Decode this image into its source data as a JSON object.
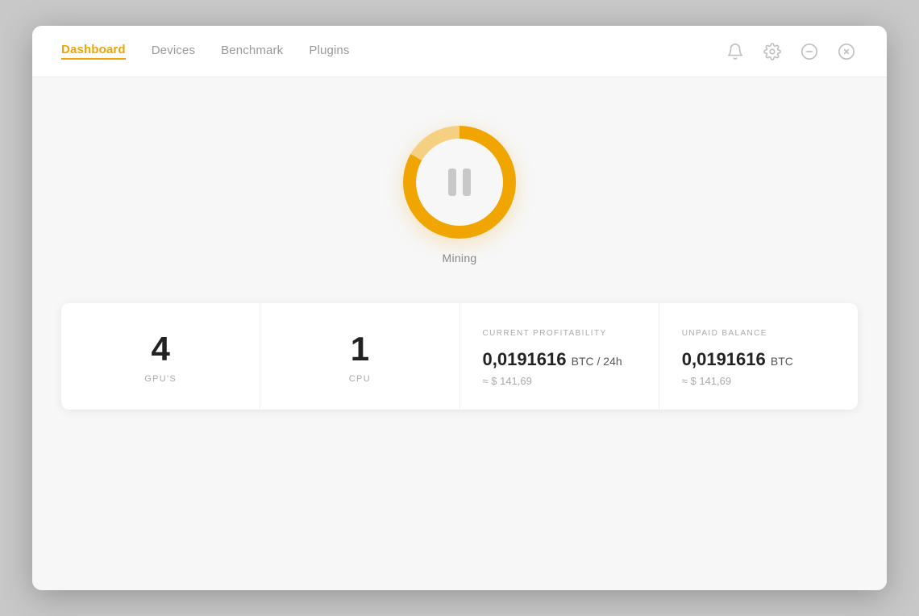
{
  "nav": {
    "items": [
      {
        "label": "Dashboard",
        "active": true
      },
      {
        "label": "Devices",
        "active": false
      },
      {
        "label": "Benchmark",
        "active": false
      },
      {
        "label": "Plugins",
        "active": false
      }
    ]
  },
  "icons": {
    "bell": "🔔",
    "settings": "⚙",
    "minimize": "⊖",
    "close": "⊗"
  },
  "mining": {
    "label": "Mining",
    "status": "paused"
  },
  "stats": {
    "gpus": {
      "value": "4",
      "label": "GPU'S"
    },
    "cpu": {
      "value": "1",
      "label": "CPU"
    },
    "profitability": {
      "title": "CURRENT PROFITABILITY",
      "btc_value": "0,0191616",
      "btc_unit": "BTC / 24h",
      "usd_approx": "≈ $ 141,69"
    },
    "balance": {
      "title": "UNPAID BALANCE",
      "btc_value": "0,0191616",
      "btc_unit": "BTC",
      "usd_approx": "≈ $ 141,69"
    }
  }
}
